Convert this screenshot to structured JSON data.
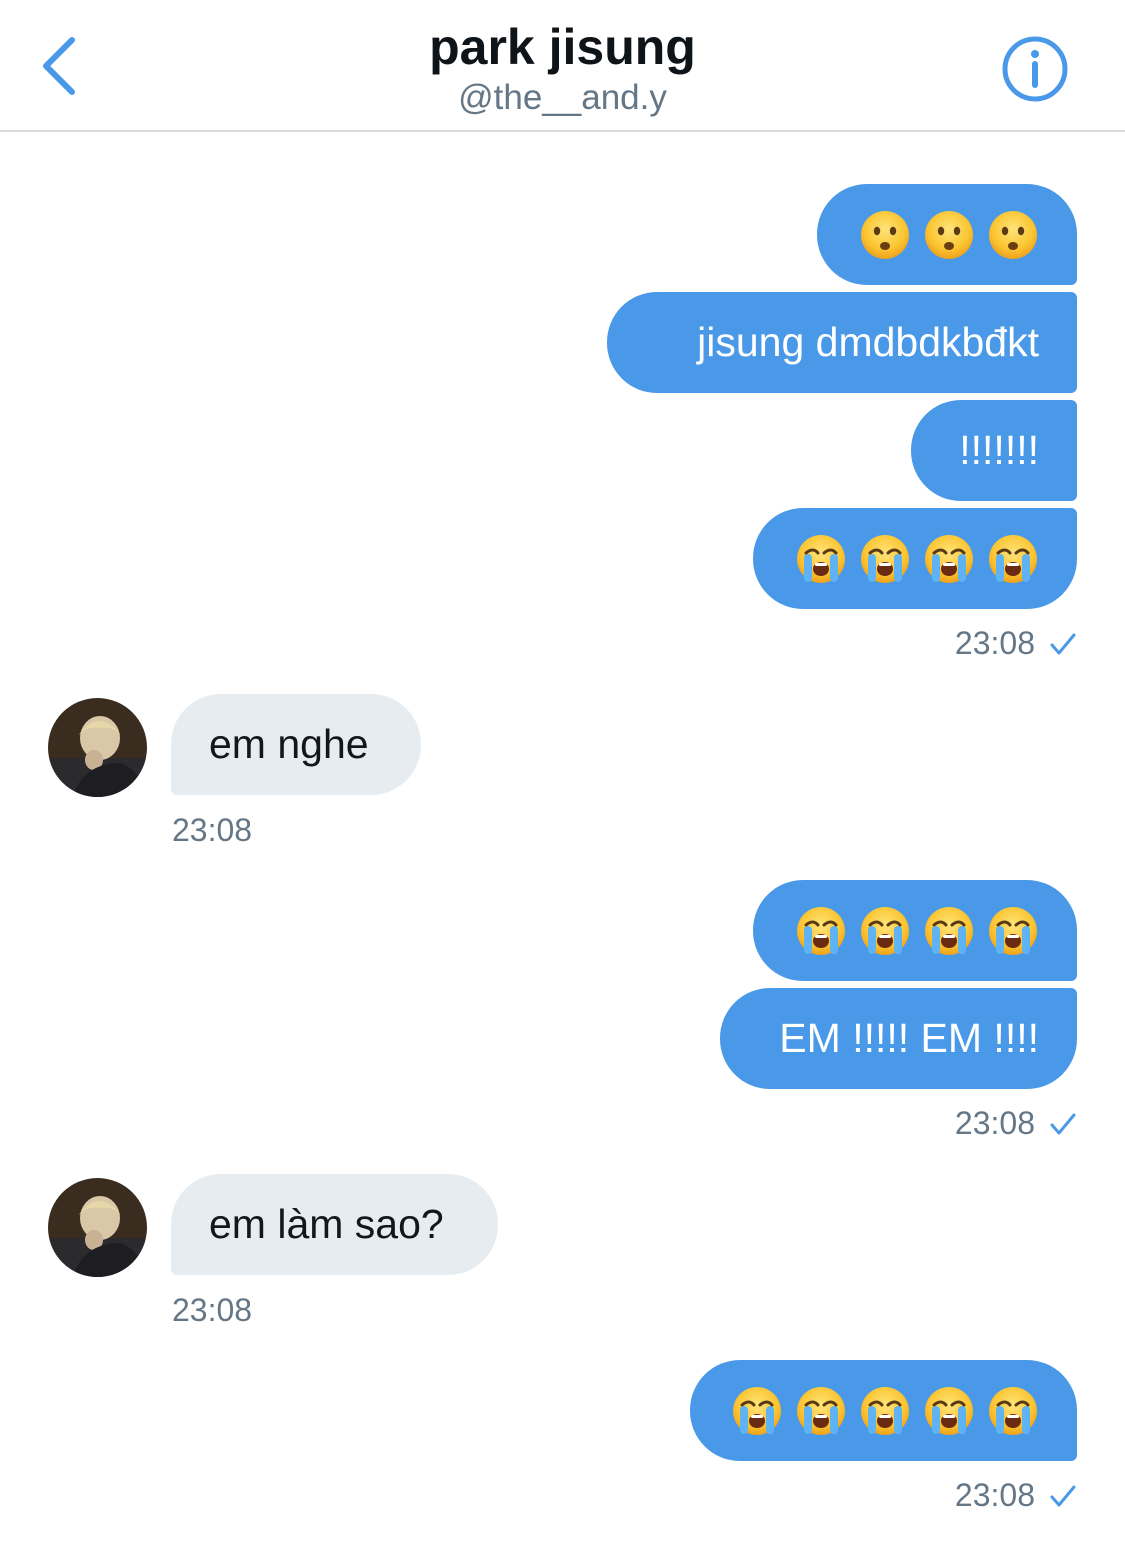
{
  "header": {
    "title": "park jisung",
    "handle": "@the__and.y"
  },
  "colors": {
    "accent": "#4a99e9",
    "incoming_bubble": "#e6ecf0",
    "meta_text": "#657786"
  },
  "icons": {
    "back": "chevron-left-icon",
    "info": "info-icon",
    "read_receipt": "checkmark-icon"
  },
  "messages": [
    {
      "id": "m1",
      "direction": "outgoing",
      "emoji": "frowning-face",
      "count": 3
    },
    {
      "id": "m2",
      "direction": "outgoing",
      "text": "jisung dmdbdkbđkt"
    },
    {
      "id": "m3",
      "direction": "outgoing",
      "text": "!!!!!!!"
    },
    {
      "id": "m4",
      "direction": "outgoing",
      "emoji": "loudly-crying-face",
      "count": 4
    },
    {
      "id": "t1",
      "direction": "outgoing",
      "time": "23:08"
    },
    {
      "id": "m5",
      "direction": "incoming",
      "text": "em nghe"
    },
    {
      "id": "t2",
      "direction": "incoming",
      "time": "23:08"
    },
    {
      "id": "m6",
      "direction": "outgoing",
      "emoji": "loudly-crying-face",
      "count": 4
    },
    {
      "id": "m7",
      "direction": "outgoing",
      "text": "EM !!!!! EM !!!!"
    },
    {
      "id": "t3",
      "direction": "outgoing",
      "time": "23:08"
    },
    {
      "id": "m8",
      "direction": "incoming",
      "text": "em làm sao?"
    },
    {
      "id": "t4",
      "direction": "incoming",
      "time": "23:08"
    },
    {
      "id": "m9",
      "direction": "outgoing",
      "emoji": "loudly-crying-face",
      "count": 5
    },
    {
      "id": "t5",
      "direction": "outgoing",
      "time": "23:08"
    }
  ],
  "labels": {
    "m2": "jisung dmdbdkbđkt",
    "m3": "!!!!!!!",
    "m5": "em nghe",
    "m7": "EM !!!!! EM !!!!",
    "m8": "em làm sao?",
    "time": "23:08"
  }
}
